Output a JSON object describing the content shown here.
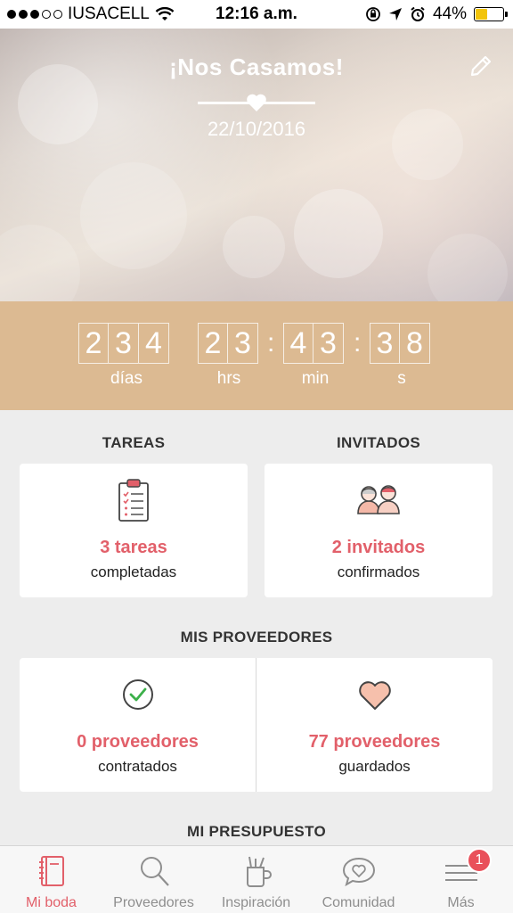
{
  "status_bar": {
    "carrier": "IUSACELL",
    "time": "12:16 a.m.",
    "battery_percent": "44%",
    "battery_level": 0.44,
    "icons": [
      "signal-dots",
      "wifi-icon",
      "rotation-lock-icon",
      "location-icon",
      "alarm-icon",
      "battery-icon"
    ]
  },
  "hero": {
    "title": "¡Nos Casamos!",
    "date": "22/10/2016",
    "edit_icon": "pencil-icon"
  },
  "countdown": {
    "days_digits": [
      "2",
      "3",
      "4"
    ],
    "hours_digits": [
      "2",
      "3"
    ],
    "minutes_digits": [
      "4",
      "3"
    ],
    "seconds_digits": [
      "3",
      "8"
    ],
    "days_label": "días",
    "hours_label": "hrs",
    "minutes_label": "min",
    "seconds_label": "s"
  },
  "tareas": {
    "title": "TAREAS",
    "count": "3 tareas",
    "sub": "completadas",
    "icon": "clipboard-checklist-icon"
  },
  "invitados": {
    "title": "INVITADOS",
    "count": "2 invitados",
    "sub": "confirmados",
    "icon": "guests-icon"
  },
  "proveedores": {
    "title": "MIS PROVEEDORES",
    "contratados": {
      "count": "0 proveedores",
      "sub": "contratados",
      "icon": "check-circle-icon"
    },
    "guardados": {
      "count": "77 proveedores",
      "sub": "guardados",
      "icon": "heart-icon"
    }
  },
  "presupuesto": {
    "title": "MI PRESUPUESTO"
  },
  "tabbar": {
    "items": [
      {
        "label": "Mi boda",
        "icon": "notebook-icon",
        "active": true
      },
      {
        "label": "Proveedores",
        "icon": "search-icon",
        "active": false
      },
      {
        "label": "Inspiración",
        "icon": "inspiration-cup-icon",
        "active": false
      },
      {
        "label": "Comunidad",
        "icon": "chat-heart-icon",
        "active": false
      },
      {
        "label": "Más",
        "icon": "menu-icon",
        "active": false,
        "badge": "1"
      }
    ]
  },
  "colors": {
    "accent": "#e2606a",
    "countdown_bg": "#dcba92",
    "background": "#ededed"
  }
}
